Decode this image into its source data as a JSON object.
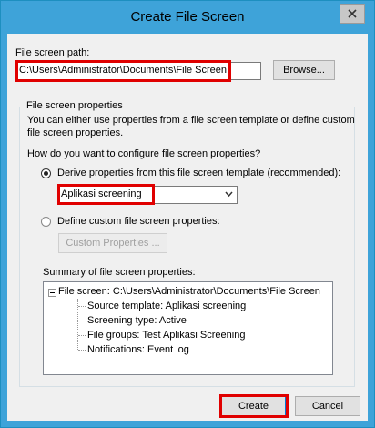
{
  "window": {
    "title": "Create File Screen",
    "close_icon": "close-icon"
  },
  "path": {
    "label": "File screen path:",
    "value": "C:\\Users\\Administrator\\Documents\\File Screen",
    "browse_label": "Browse..."
  },
  "properties": {
    "group_label": "File screen properties",
    "intro": [
      "You can either use properties from a file screen template or define custom",
      "file screen properties."
    ],
    "question": "How do you want to configure file screen properties?",
    "option_template_label": "Derive properties from this file screen template (recommended):",
    "option_template_checked": true,
    "template_selected": "Aplikasi screening",
    "option_custom_label": "Define custom file screen properties:",
    "option_custom_checked": false,
    "custom_button_label": "Custom Properties ..."
  },
  "summary": {
    "label": "Summary of file screen properties:",
    "root": "File screen: C:\\Users\\Administrator\\Documents\\File Screen",
    "items": [
      "Source template: Aplikasi screening",
      "Screening type: Active",
      "File groups: Test Aplikasi Screening",
      "Notifications: Event log"
    ]
  },
  "footer": {
    "create_label": "Create",
    "cancel_label": "Cancel"
  },
  "colors": {
    "titlebar": "#3ea3d9",
    "highlight": "#e00000",
    "dialog_bg": "#f0f0f0"
  }
}
